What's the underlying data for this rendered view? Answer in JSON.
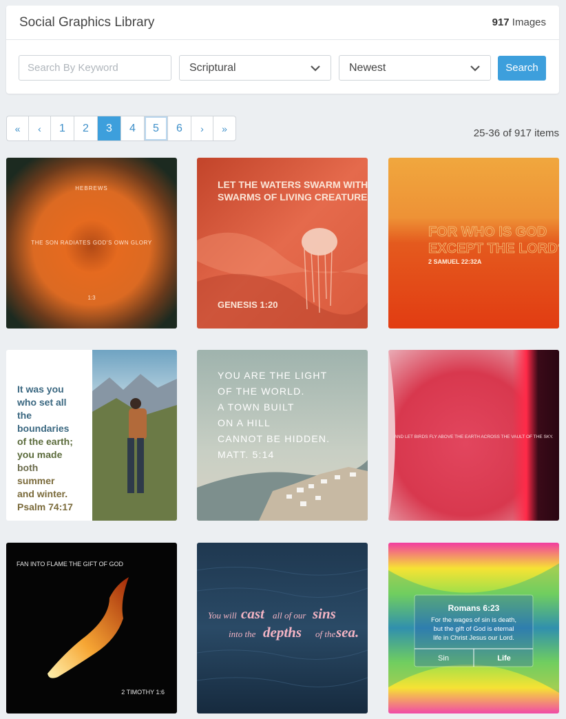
{
  "header": {
    "title": "Social Graphics Library",
    "count_number": "917",
    "count_label": " Images"
  },
  "filters": {
    "search_placeholder": "Search By Keyword",
    "category_selected": "Scriptural",
    "sort_selected": "Newest",
    "search_button": "Search"
  },
  "pagination": {
    "first": "«",
    "prev": "‹",
    "pages": [
      "1",
      "2",
      "3",
      "4",
      "5",
      "6"
    ],
    "current": "3",
    "next": "›",
    "last": "»",
    "range_text": "25-36 of 917 items"
  },
  "tiles": [
    {
      "top": "HEBREWS",
      "middle": "THE SON RADIATES GOD'S OWN GLORY",
      "bottom": "1:3"
    },
    {
      "line1": "LET THE WATERS SWARM WITH",
      "line2": "SWARMS OF LIVING CREATURES",
      "ref": "GENESIS 1:20"
    },
    {
      "line1": "FOR WHO IS GOD",
      "line2": "EXCEPT THE LORD?",
      "ref": "2 SAMUEL 22:32A"
    },
    {
      "lines": [
        "It was you",
        "who set all",
        "the",
        "boundaries",
        "of the earth;",
        "you made",
        "both",
        "summer",
        "and winter."
      ],
      "ref": "Psalm 74:17"
    },
    {
      "lines": [
        "YOU ARE THE LIGHT",
        "OF THE WORLD.",
        "A TOWN BUILT",
        "ON A HILL",
        "CANNOT BE HIDDEN.",
        "MATT. 5:14"
      ]
    },
    {
      "text": "AND LET BIRDS FLY ABOVE THE EARTH ACROSS THE VAULT OF THE SKY."
    },
    {
      "top": "FAN INTO FLAME THE GIFT OF GOD",
      "ref": "2 TIMOTHY 1:6"
    },
    {
      "w1": "You will",
      "w2": "cast",
      "w3": "all of our",
      "w4": "sins",
      "w5": "into the",
      "w6": "depths",
      "w7": "of the",
      "w8": "sea."
    },
    {
      "title": "Romans 6:23",
      "l1": "For the wages of sin is death,",
      "l2": "but the gift of God is eternal",
      "l3": "life in Christ Jesus our Lord.",
      "left": "Sin",
      "right": "Life"
    }
  ]
}
